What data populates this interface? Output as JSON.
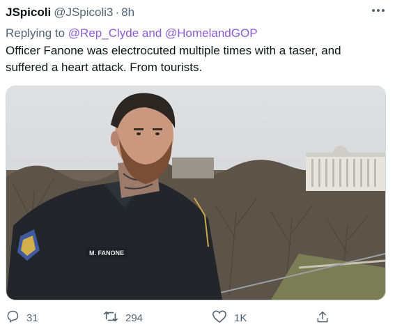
{
  "tweet": {
    "display_name": "JSpicoli",
    "handle": "@JSpicoli3",
    "separator": "·",
    "time": "8h",
    "more_icon": "more-horizontal-icon",
    "reply_prefix": "Replying to",
    "reply_to_1": "@Rep_Clyde",
    "reply_and": "and",
    "reply_to_2": "@HomelandGOP",
    "text": "Officer Fanone was electrocuted multiple times with a taser, and suffered a heart attack. From tourists.",
    "image": {
      "name_tag": "M. FANONE",
      "description_icon": "photo"
    },
    "actions": {
      "reply_count": "31",
      "retweet_count": "294",
      "like_count": "1K"
    }
  },
  "colors": {
    "text": "#0f1419",
    "secondary": "#536471",
    "mention": "#8a5cd8"
  }
}
